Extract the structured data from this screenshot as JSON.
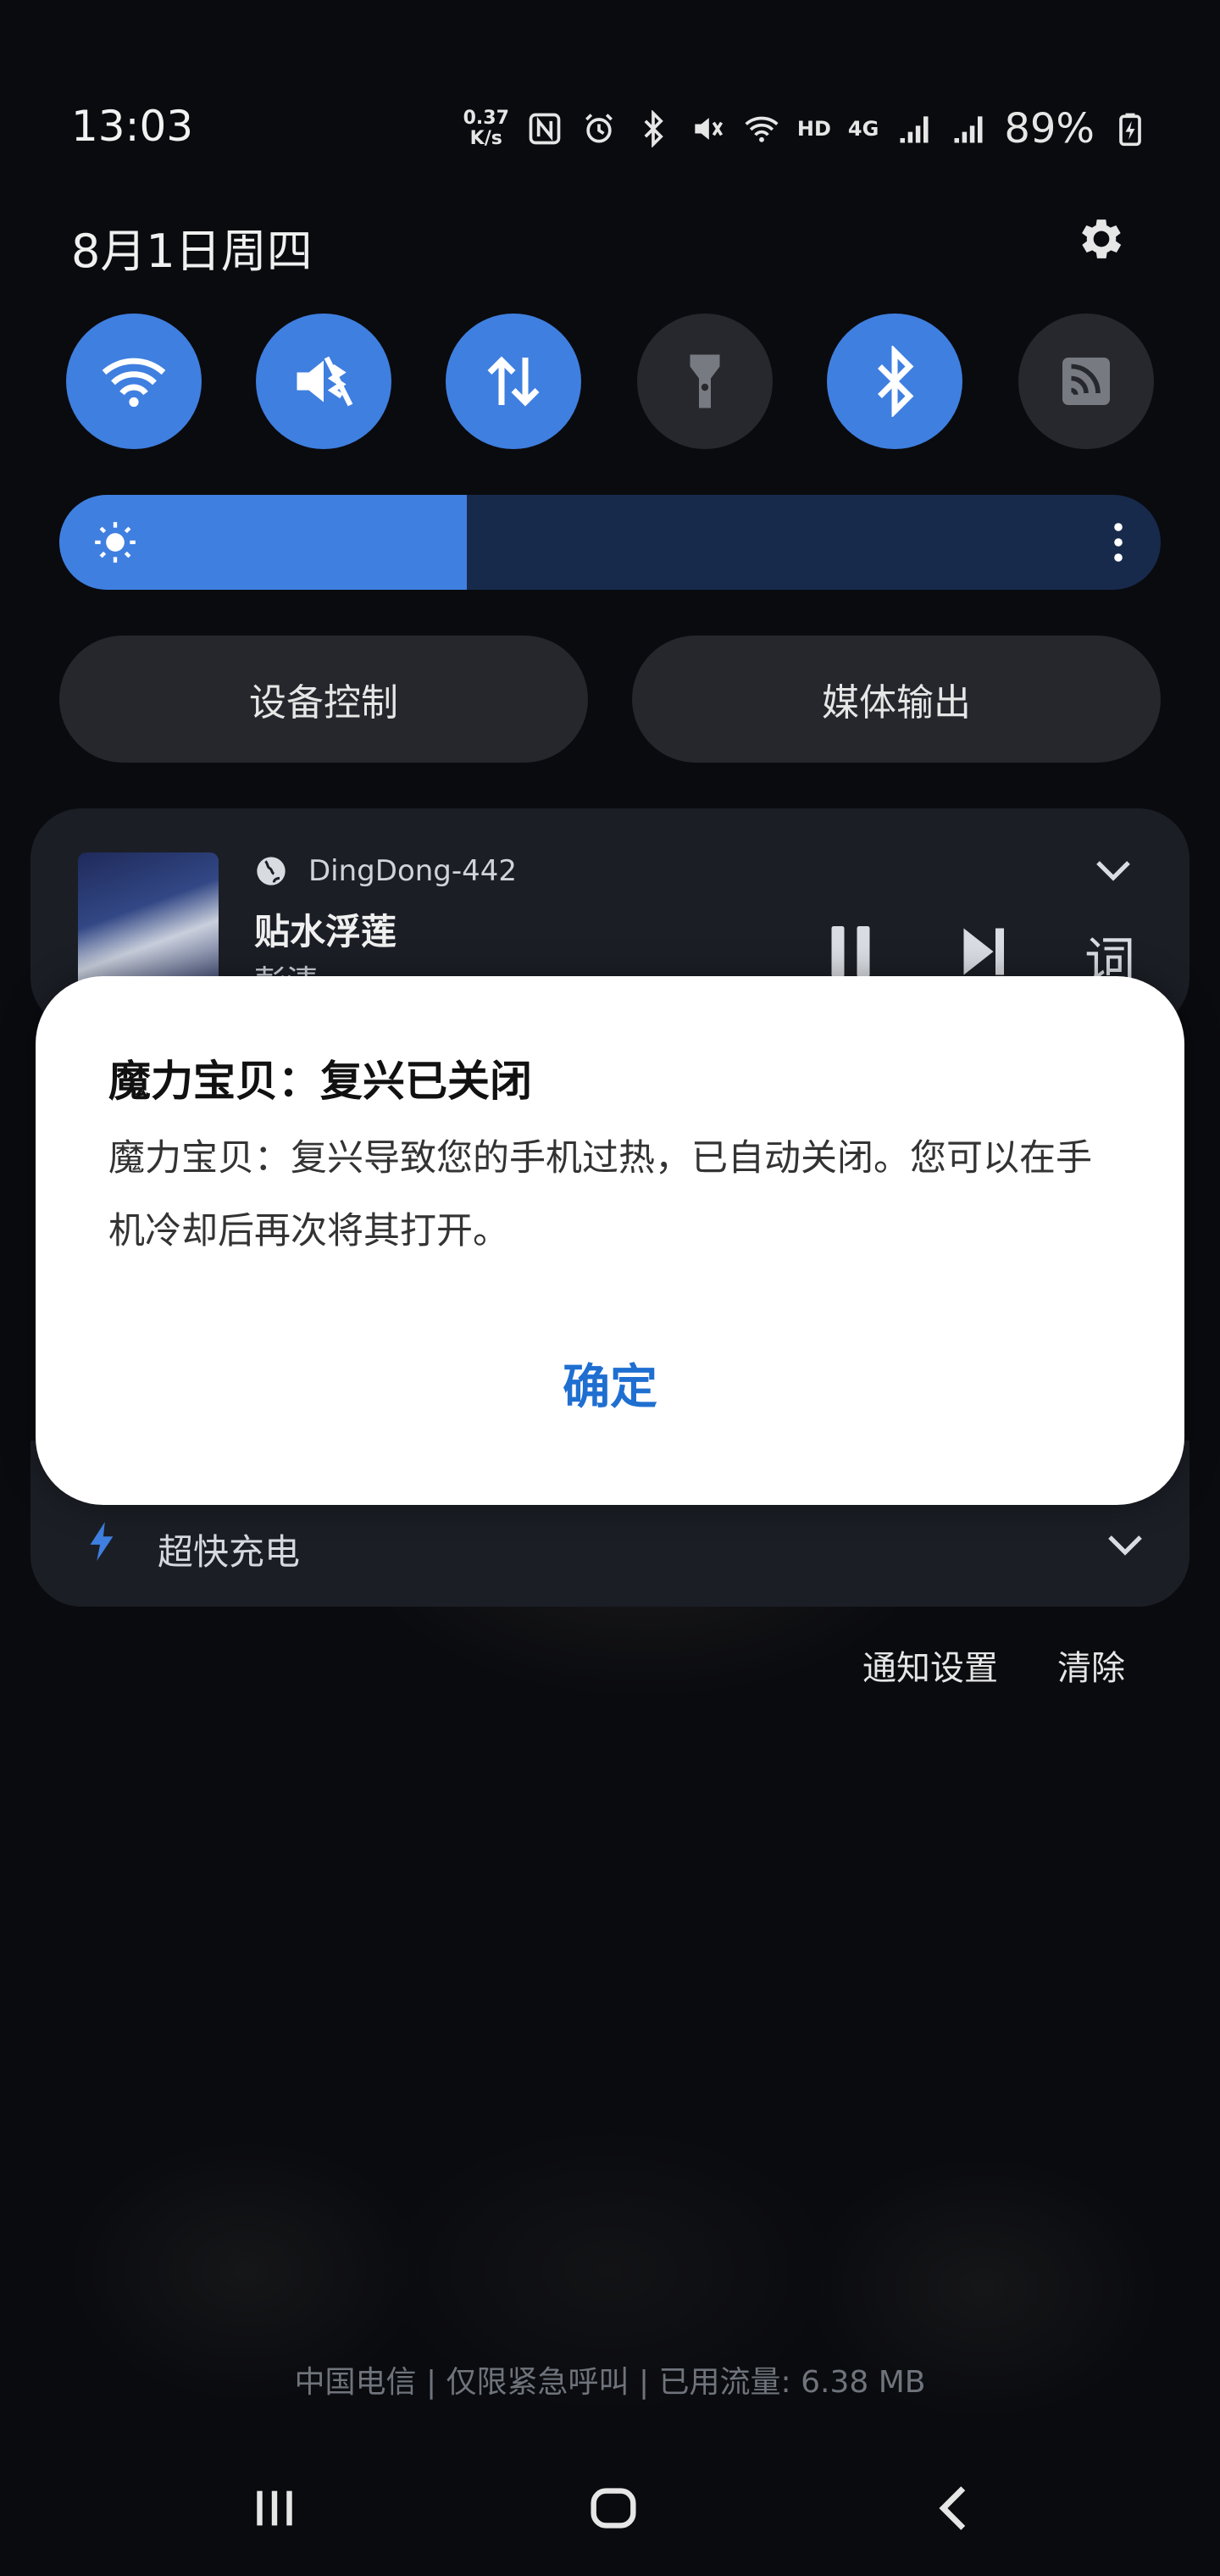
{
  "status_bar": {
    "time": "13:03",
    "net_speed_value": "0.37",
    "net_speed_unit": "K/s",
    "hd_label": "HD",
    "lte_label": "4G",
    "battery": "89%",
    "icons": [
      "nfc-icon",
      "alarm-icon",
      "bluetooth-icon",
      "mute-icon",
      "wifi-icon",
      "signal-icon",
      "signal-icon",
      "battery-charging-icon"
    ]
  },
  "header": {
    "date": "8月1日周四",
    "settings_icon": "gear-icon"
  },
  "quick_toggles": [
    {
      "icon": "wifi-icon",
      "state": "on"
    },
    {
      "icon": "vibrate-mute-icon",
      "state": "on"
    },
    {
      "icon": "mobile-data-icon",
      "state": "on"
    },
    {
      "icon": "flashlight-icon",
      "state": "off"
    },
    {
      "icon": "bluetooth-icon",
      "state": "on"
    },
    {
      "icon": "cast-icon",
      "state": "off"
    }
  ],
  "brightness": {
    "level": 0.37,
    "icon": "sun-icon"
  },
  "pills": {
    "device_control": "设备控制",
    "media_output": "媒体输出"
  },
  "media": {
    "app_name": "DingDong-442",
    "title": "贴水浮莲",
    "artist": "彭清",
    "lyrics_label": "词"
  },
  "charging": {
    "label": "超快充电"
  },
  "notif_actions": {
    "settings": "通知设置",
    "clear": "清除"
  },
  "dialog": {
    "title": "魔力宝贝：复兴已关闭",
    "body": "魔力宝贝：复兴导致您的手机过热，已自动关闭。您可以在手机冷却后再次将其打开。",
    "ok": "确定"
  },
  "carrier": {
    "text": "中国电信 | 仅限紧急呼叫 | 已用流量: 6.38 MB"
  },
  "colors": {
    "accent": "#3f7fe0",
    "dialog_button": "#1f6fd1",
    "background": "#0a0b0f",
    "card": "#1b1e25"
  }
}
